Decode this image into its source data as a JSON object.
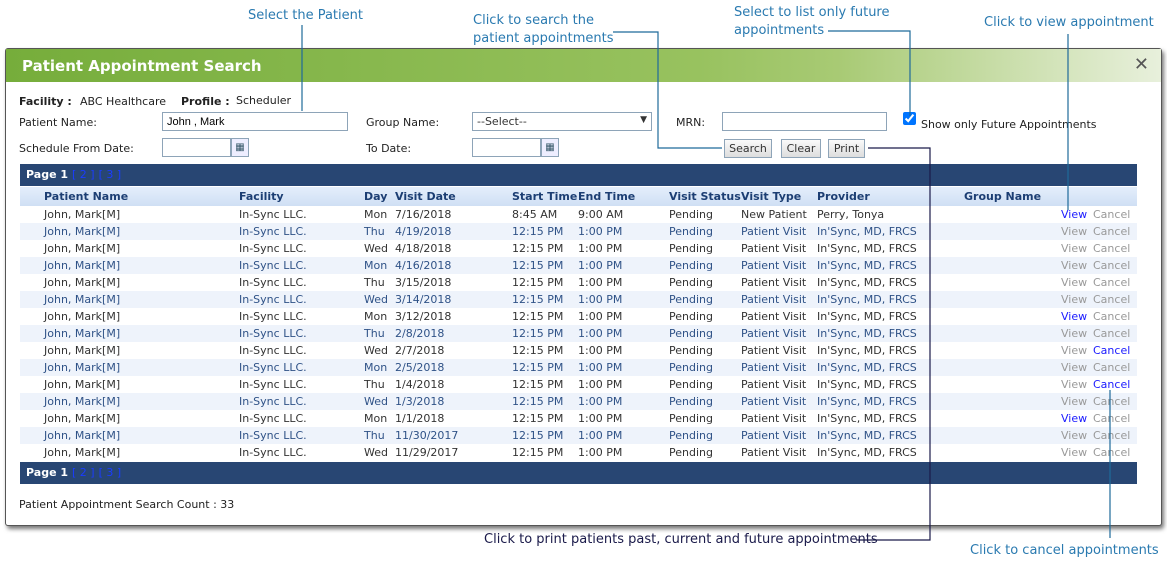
{
  "annotations": {
    "select_patient": "Select the Patient",
    "search": "Click to search the patient appointments",
    "future": "Select to list only future appointments",
    "view": "Click to view appointment",
    "print": "Click to print patients past, current and future appointments",
    "cancel": "Click to cancel appointments"
  },
  "dialog": {
    "title": "Patient Appointment Search",
    "close_icon": "close-x",
    "facility_label": "Facility :",
    "facility_value": "ABC Healthcare",
    "profile_label": "Profile :",
    "profile_value": "Scheduler",
    "patient_name_label": "Patient Name:",
    "patient_name_value": "John , Mark",
    "group_name_label": "Group Name:",
    "group_name_value": "--Select--",
    "mrn_label": "MRN:",
    "mrn_value": "",
    "future_checkbox_label": "Show only Future Appointments",
    "future_checked": true,
    "from_date_label": "Schedule From Date:",
    "from_date_value": "",
    "to_date_label": "To Date:",
    "to_date_value": "",
    "search_label": "Search",
    "clear_label": "Clear",
    "print_label": "Print",
    "page_label": "Page 1",
    "page_links": [
      "[ 2 ]",
      "[ 3 ]"
    ],
    "count_label": "Patient Appointment Search Count : 33"
  },
  "table": {
    "headers": [
      "Patient Name",
      "Facility",
      "Day",
      "Visit Date",
      "Start Time",
      "End Time",
      "Visit Status",
      "Visit Type",
      "Provider",
      "Group Name"
    ],
    "view_label": "View",
    "cancel_label": "Cancel",
    "rows": [
      {
        "name": "John, Mark[M]",
        "facility": "In-Sync LLC.",
        "day": "Mon",
        "date": "7/16/2018",
        "start": "8:45 AM",
        "end": "9:00 AM",
        "status": "Pending",
        "type": "New Patient",
        "provider": "Perry, Tonya",
        "group": "",
        "view_active": true,
        "cancel_active": false
      },
      {
        "name": "John, Mark[M]",
        "facility": "In-Sync LLC.",
        "day": "Thu",
        "date": "4/19/2018",
        "start": "12:15 PM",
        "end": "1:00 PM",
        "status": "Pending",
        "type": "Patient Visit",
        "provider": "In'Sync, MD, FRCS",
        "group": "",
        "view_active": false,
        "cancel_active": false
      },
      {
        "name": "John, Mark[M]",
        "facility": "In-Sync LLC.",
        "day": "Wed",
        "date": "4/18/2018",
        "start": "12:15 PM",
        "end": "1:00 PM",
        "status": "Pending",
        "type": "Patient Visit",
        "provider": "In'Sync, MD, FRCS",
        "group": "",
        "view_active": false,
        "cancel_active": false
      },
      {
        "name": "John, Mark[M]",
        "facility": "In-Sync LLC.",
        "day": "Mon",
        "date": "4/16/2018",
        "start": "12:15 PM",
        "end": "1:00 PM",
        "status": "Pending",
        "type": "Patient Visit",
        "provider": "In'Sync, MD, FRCS",
        "group": "",
        "view_active": false,
        "cancel_active": false
      },
      {
        "name": "John, Mark[M]",
        "facility": "In-Sync LLC.",
        "day": "Thu",
        "date": "3/15/2018",
        "start": "12:15 PM",
        "end": "1:00 PM",
        "status": "Pending",
        "type": "Patient Visit",
        "provider": "In'Sync, MD, FRCS",
        "group": "",
        "view_active": false,
        "cancel_active": false
      },
      {
        "name": "John, Mark[M]",
        "facility": "In-Sync LLC.",
        "day": "Wed",
        "date": "3/14/2018",
        "start": "12:15 PM",
        "end": "1:00 PM",
        "status": "Pending",
        "type": "Patient Visit",
        "provider": "In'Sync, MD, FRCS",
        "group": "",
        "view_active": false,
        "cancel_active": false
      },
      {
        "name": "John, Mark[M]",
        "facility": "In-Sync LLC.",
        "day": "Mon",
        "date": "3/12/2018",
        "start": "12:15 PM",
        "end": "1:00 PM",
        "status": "Pending",
        "type": "Patient Visit",
        "provider": "In'Sync, MD, FRCS",
        "group": "",
        "view_active": true,
        "cancel_active": false
      },
      {
        "name": "John, Mark[M]",
        "facility": "In-Sync LLC.",
        "day": "Thu",
        "date": "2/8/2018",
        "start": "12:15 PM",
        "end": "1:00 PM",
        "status": "Pending",
        "type": "Patient Visit",
        "provider": "In'Sync, MD, FRCS",
        "group": "",
        "view_active": false,
        "cancel_active": false
      },
      {
        "name": "John, Mark[M]",
        "facility": "In-Sync LLC.",
        "day": "Wed",
        "date": "2/7/2018",
        "start": "12:15 PM",
        "end": "1:00 PM",
        "status": "Pending",
        "type": "Patient Visit",
        "provider": "In'Sync, MD, FRCS",
        "group": "",
        "view_active": false,
        "cancel_active": true
      },
      {
        "name": "John, Mark[M]",
        "facility": "In-Sync LLC.",
        "day": "Mon",
        "date": "2/5/2018",
        "start": "12:15 PM",
        "end": "1:00 PM",
        "status": "Pending",
        "type": "Patient Visit",
        "provider": "In'Sync, MD, FRCS",
        "group": "",
        "view_active": false,
        "cancel_active": false
      },
      {
        "name": "John, Mark[M]",
        "facility": "In-Sync LLC.",
        "day": "Thu",
        "date": "1/4/2018",
        "start": "12:15 PM",
        "end": "1:00 PM",
        "status": "Pending",
        "type": "Patient Visit",
        "provider": "In'Sync, MD, FRCS",
        "group": "",
        "view_active": false,
        "cancel_active": true
      },
      {
        "name": "John, Mark[M]",
        "facility": "In-Sync LLC.",
        "day": "Wed",
        "date": "1/3/2018",
        "start": "12:15 PM",
        "end": "1:00 PM",
        "status": "Pending",
        "type": "Patient Visit",
        "provider": "In'Sync, MD, FRCS",
        "group": "",
        "view_active": false,
        "cancel_active": false
      },
      {
        "name": "John, Mark[M]",
        "facility": "In-Sync LLC.",
        "day": "Mon",
        "date": "1/1/2018",
        "start": "12:15 PM",
        "end": "1:00 PM",
        "status": "Pending",
        "type": "Patient Visit",
        "provider": "In'Sync, MD, FRCS",
        "group": "",
        "view_active": true,
        "cancel_active": false
      },
      {
        "name": "John, Mark[M]",
        "facility": "In-Sync LLC.",
        "day": "Thu",
        "date": "11/30/2017",
        "start": "12:15 PM",
        "end": "1:00 PM",
        "status": "Pending",
        "type": "Patient Visit",
        "provider": "In'Sync, MD, FRCS",
        "group": "",
        "view_active": false,
        "cancel_active": false
      },
      {
        "name": "John, Mark[M]",
        "facility": "In-Sync LLC.",
        "day": "Wed",
        "date": "11/29/2017",
        "start": "12:15 PM",
        "end": "1:00 PM",
        "status": "Pending",
        "type": "Patient Visit",
        "provider": "In'Sync, MD, FRCS",
        "group": "",
        "view_active": false,
        "cancel_active": false
      }
    ]
  }
}
